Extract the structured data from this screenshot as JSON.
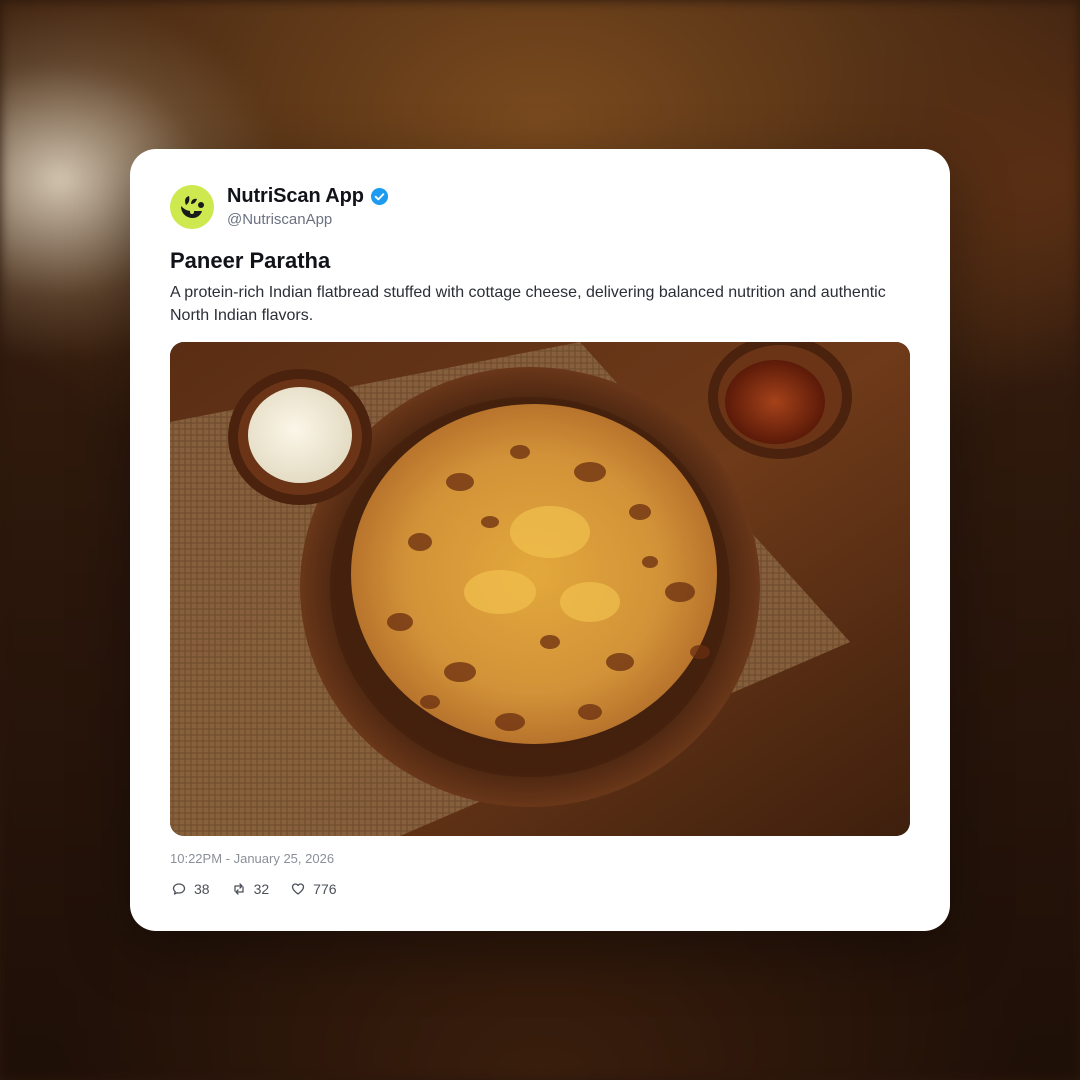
{
  "post": {
    "author": {
      "display_name": "NutriScan App",
      "handle": "@NutriscanApp",
      "verified": true,
      "avatar_color": "#cde94f"
    },
    "title": "Paneer Paratha",
    "description": "A protein-rich Indian flatbread stuffed with cottage cheese, delivering balanced nutrition and authentic North Indian flavors.",
    "timestamp": "10:22PM - January 25, 2026",
    "stats": {
      "replies": "38",
      "retweets": "32",
      "likes": "776"
    }
  },
  "icons": {
    "reply": "comment-icon",
    "retweet": "retweet-icon",
    "like": "heart-icon",
    "verified": "verified-badge-icon"
  },
  "colors": {
    "verified_blue": "#1d9bf0",
    "text_primary": "#111318",
    "text_secondary": "#6b7280"
  }
}
